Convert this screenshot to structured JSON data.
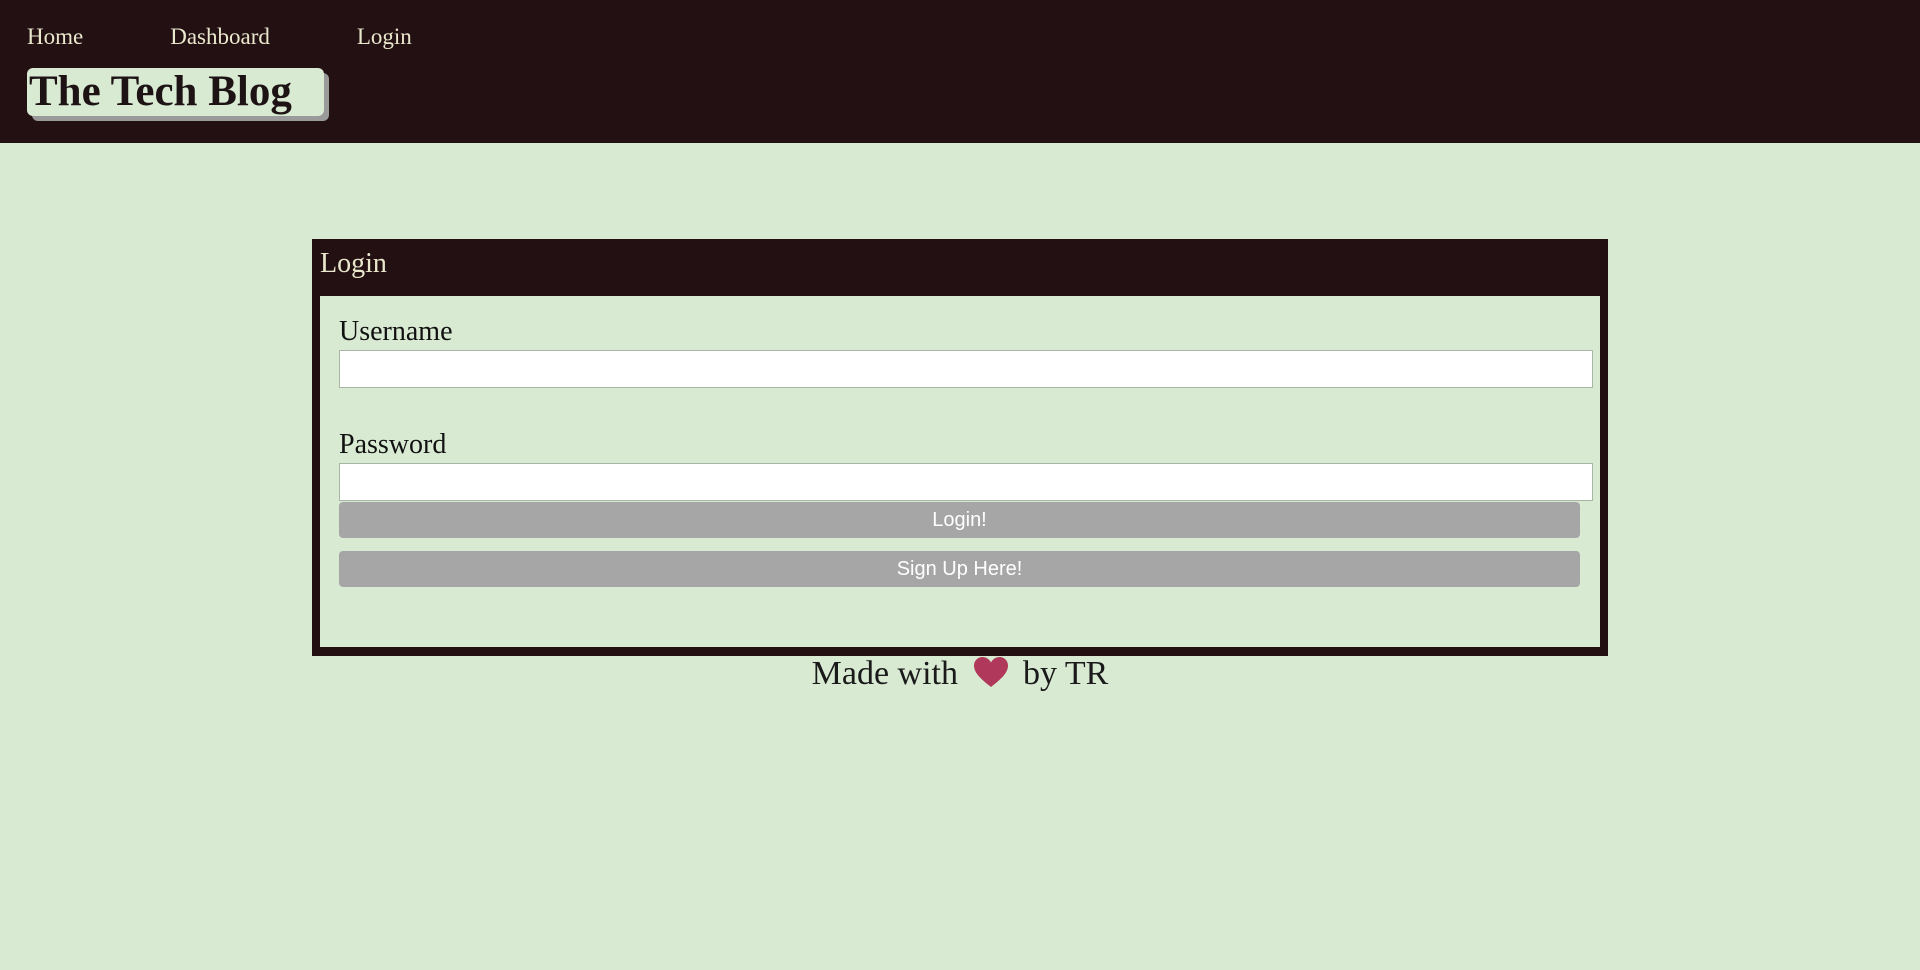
{
  "nav": {
    "items": [
      {
        "label": "Home"
      },
      {
        "label": "Dashboard"
      },
      {
        "label": "Login"
      }
    ]
  },
  "brand": {
    "title": "The Tech Blog"
  },
  "login_card": {
    "header": "Login",
    "username": {
      "label": "Username",
      "value": "",
      "placeholder": ""
    },
    "password": {
      "label": "Password",
      "value": "",
      "placeholder": ""
    },
    "login_button": "Login!",
    "signup_button": "Sign Up Here!"
  },
  "footer": {
    "prefix": "Made with",
    "icon": "heart-icon",
    "suffix": "by TR"
  },
  "colors": {
    "header_bg": "#231013",
    "page_bg": "#d9ead3",
    "nav_text": "#eae8cc",
    "button_bg": "#a6a6a6",
    "heart": "#b0385a"
  }
}
